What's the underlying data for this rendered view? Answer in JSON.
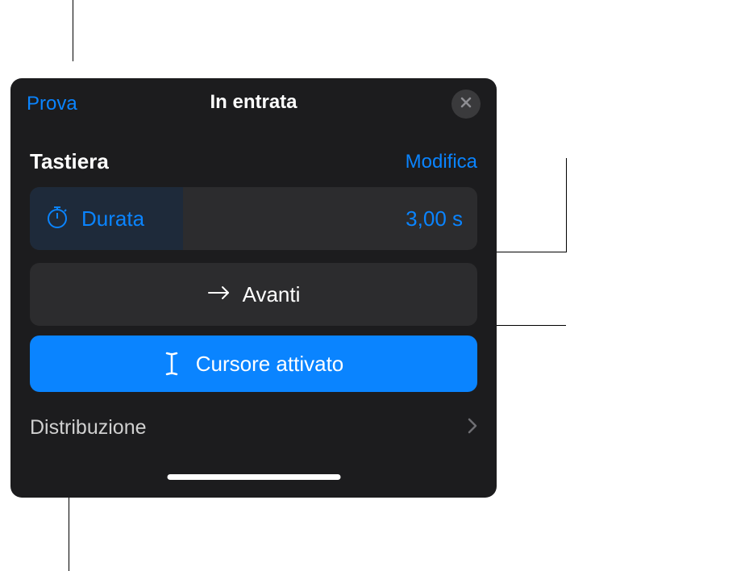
{
  "header": {
    "prova_label": "Prova",
    "title": "In entrata"
  },
  "section": {
    "title": "Tastiera",
    "modifica_label": "Modifica"
  },
  "durata": {
    "label": "Durata",
    "value": "3,00 s"
  },
  "avanti": {
    "label": "Avanti"
  },
  "cursore": {
    "label": "Cursore attivato"
  },
  "distribuzione": {
    "label": "Distribuzione"
  }
}
